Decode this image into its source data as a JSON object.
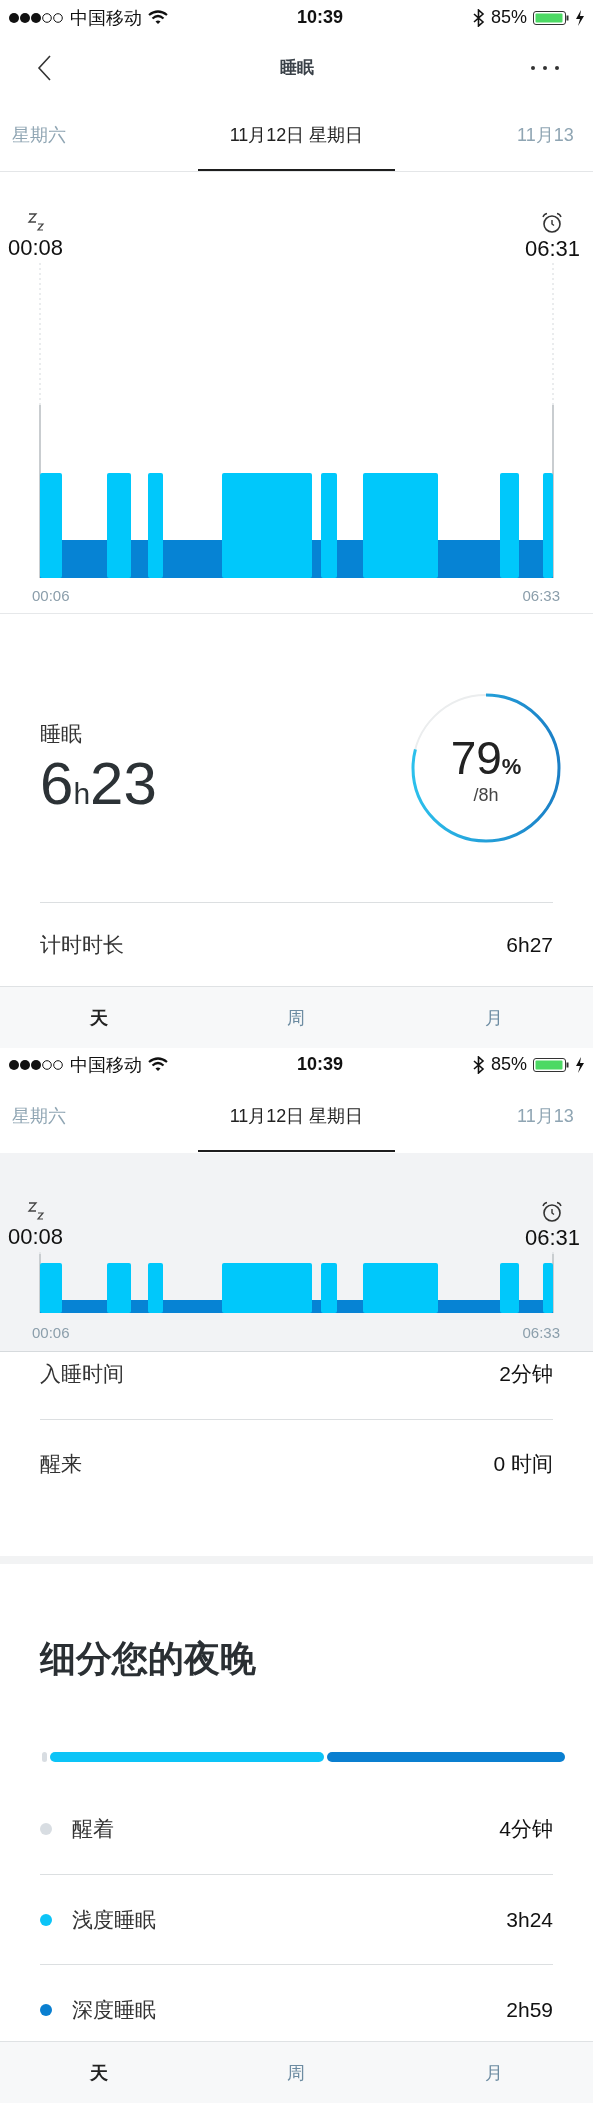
{
  "screens": [
    {
      "status_bar": {
        "carrier": "中国移动",
        "time": "10:39",
        "battery": "85%"
      },
      "nav": {
        "title": "睡眠"
      },
      "date_tabs": [
        {
          "label": "星期六",
          "selected": false
        },
        {
          "label": "11月12日 星期日",
          "selected": true
        },
        {
          "label": "11月13",
          "selected": false
        }
      ],
      "chart": {
        "kind": "tall",
        "sleep_time": "00:08",
        "wake_time": "06:31",
        "axis_start": "00:06",
        "axis_end": "06:33"
      },
      "summary": {
        "label": "睡眠",
        "hours": "6",
        "hours_unit": "h",
        "minutes": "23",
        "percent": "79",
        "percent_unit": "%",
        "goal": "/8h"
      },
      "rows": [
        {
          "label": "计时时长",
          "value": "6h27"
        }
      ],
      "bottom_tabs": [
        {
          "label": "天",
          "selected": true
        },
        {
          "label": "周",
          "selected": false
        },
        {
          "label": "月",
          "selected": false
        }
      ]
    },
    {
      "status_bar": {
        "carrier": "中国移动",
        "time": "10:39",
        "battery": "85%"
      },
      "date_tabs": [
        {
          "label": "星期六",
          "selected": false
        },
        {
          "label": "11月12日 星期日",
          "selected": true
        },
        {
          "label": "11月13",
          "selected": false
        }
      ],
      "chart": {
        "kind": "compact",
        "sleep_time": "00:08",
        "wake_time": "06:31",
        "axis_start": "00:06",
        "axis_end": "06:33"
      },
      "rows": [
        {
          "label": "入睡时间",
          "value": "2分钟"
        },
        {
          "label": "醒来",
          "value": "0 时间"
        }
      ],
      "breakdown": {
        "title": "细分您的夜晚",
        "stages": [
          {
            "label": "醒着",
            "value": "4分钟",
            "color": "#d8dde2"
          },
          {
            "label": "浅度睡眠",
            "value": "3h24",
            "color": "#0cc4f7"
          },
          {
            "label": "深度睡眠",
            "value": "2h59",
            "color": "#0a7fd0"
          }
        ]
      },
      "bottom_tabs": [
        {
          "label": "天",
          "selected": true
        },
        {
          "label": "周",
          "selected": false
        },
        {
          "label": "月",
          "selected": false
        }
      ]
    }
  ]
}
